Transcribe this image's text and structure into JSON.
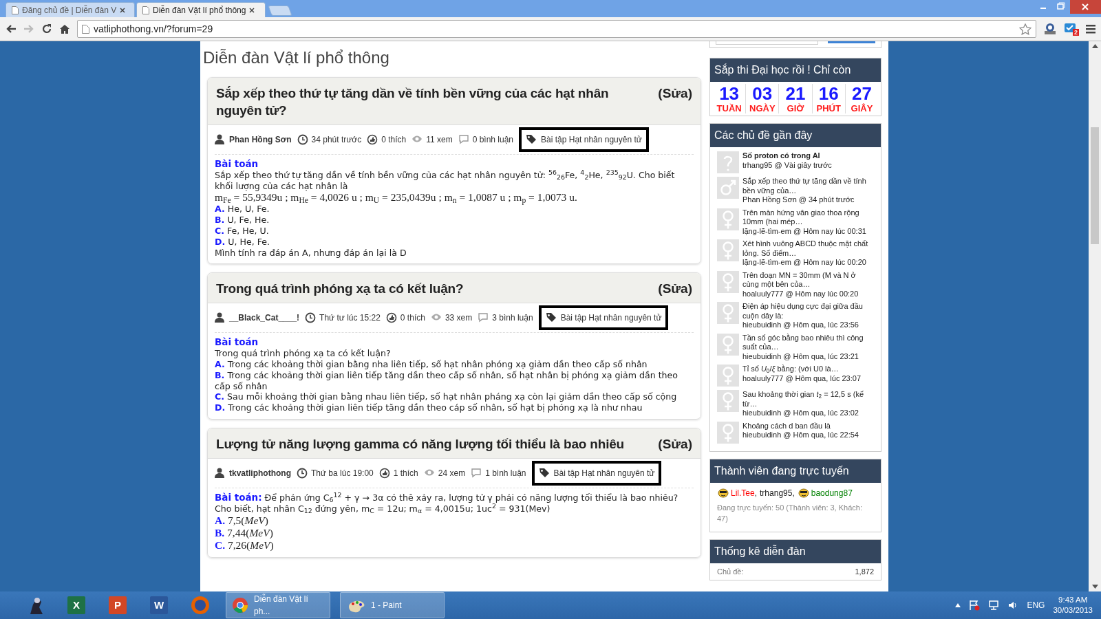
{
  "browser": {
    "tabs": [
      {
        "title": "Đăng chủ đề | Diễn đàn V",
        "selected": false
      },
      {
        "title": "Diễn đàn Vật lí phổ thông",
        "selected": true
      }
    ],
    "address": "vatliphothong.vn/?forum=29",
    "extension_badge": "2"
  },
  "forum": {
    "title": "Diễn đàn Vật lí phổ thông",
    "posts": [
      {
        "title": "Sắp xếp theo thứ tự tăng dần về tính bền vững của các hạt nhân nguyên tử?",
        "edit_label": "(Sửa)",
        "author": "Phan Hồng Sơn",
        "time": "34 phút trước",
        "likes": "0 thích",
        "views": "11 xem",
        "comments": "0 bình luận",
        "tag": "Bài tập Hạt nhân nguyên tử",
        "tag_highlighted": true,
        "body": [
          {
            "kind": "heading",
            "text": "Bài toán"
          },
          {
            "kind": "text",
            "text": "Sắp xếp theo thứ tự tăng dần về tính bền vững của các hạt nhân nguyên tử: $^{56}$$_{26}$Fe, $^{4}$$_{2}$He, $^{235}$$_{92}$U. Cho biết khối lượng của các hạt nhân là"
          },
          {
            "kind": "math",
            "text": "m$_{Fe}$ = 55,9349u ; m$_{He}$ = 4,0026 u ; m$_{U}$ = 235,0439u ; m$_{n}$ = 1,0087 u ; m$_{p}$ = 1,0073 u."
          },
          {
            "kind": "option",
            "letter": "A.",
            "text": "He, U, Fe."
          },
          {
            "kind": "option",
            "letter": "B.",
            "text": "U, Fe, He."
          },
          {
            "kind": "option",
            "letter": "C.",
            "text": "Fe, He, U."
          },
          {
            "kind": "option",
            "letter": "D.",
            "text": "U, He, Fe."
          },
          {
            "kind": "text",
            "text": "Mình tính ra đáp án A, nhưng đáp án lại là D"
          }
        ]
      },
      {
        "title": "Trong quá trình phóng xạ ta có kết luận?",
        "edit_label": "(Sửa)",
        "author": "__Black_Cat____!",
        "time": "Thứ tư lúc 15:22",
        "likes": "0 thích",
        "views": "33 xem",
        "comments": "3 bình luận",
        "tag": "Bài tập Hạt nhân nguyên tử",
        "tag_highlighted": true,
        "body": [
          {
            "kind": "heading",
            "text": "Bài toán"
          },
          {
            "kind": "text",
            "text": "Trong quá trình phóng xạ ta có kết luận?"
          },
          {
            "kind": "option",
            "letter": "A.",
            "text": "Trong các khoảng thời gian bằng nha liên tiếp, số hạt nhân phóng xạ giảm dần theo cấp số nhân"
          },
          {
            "kind": "option",
            "letter": "B.",
            "text": "Trong các khoảng thời gian liên tiếp tăng dần theo cấp số nhân, số hạt nhân bị phóng xạ giảm dần theo cấp số nhân"
          },
          {
            "kind": "option",
            "letter": "C.",
            "text": "Sau mỗi khoảng thời gian bằng nhau liên tiếp, số hạt nhân pháng xạ còn lại giảm dần theo cấp số cộng"
          },
          {
            "kind": "option",
            "letter": "D.",
            "text": "Trong các khoảng thời gian liên tiếp tăng dần theo cáp số nhân, số hạt bị phóng xạ là như nhau"
          }
        ]
      },
      {
        "title": "Lượng tử năng lượng gamma có năng lượng tối thiểu là bao nhiêu",
        "edit_label": "(Sửa)",
        "author": "tkvatliphothong",
        "time": "Thứ ba lúc 19:00",
        "likes": "1 thích",
        "views": "24 xem",
        "comments": "1 bình luận",
        "tag": "Bài tập Hạt nhân nguyên tử",
        "tag_highlighted": true,
        "body": [
          {
            "kind": "lead",
            "label": "Bài toán:",
            "text": "Để phản ứng C$_{6}$$^{12}$ + γ → 3α có thê xảy ra, lượng tử γ phải có năng lượng tối thiểu là bao nhiêu? Cho biết, hạt nhân C$_{12}$ đứng yên, m$_{C}$ = 12u; m$_{α}$ = 4,0015u; 1uc$^{2}$ = 931(Mev)"
          },
          {
            "kind": "math_option",
            "letter": "A.",
            "text": "7,5(*MeV*)"
          },
          {
            "kind": "math_option",
            "letter": "B.",
            "text": "7,44(*MeV*)"
          },
          {
            "kind": "math_option",
            "letter": "C.",
            "text": "7,26(*MeV*)"
          }
        ]
      }
    ]
  },
  "sidebar": {
    "countdown": {
      "title": "Sắp thi Đại học rồi ! Chỉ còn",
      "units": [
        {
          "value": "13",
          "label": "TUẦN"
        },
        {
          "value": "03",
          "label": "NGÀY"
        },
        {
          "value": "21",
          "label": "GIỜ"
        },
        {
          "value": "16",
          "label": "PHÚT"
        },
        {
          "value": "27",
          "label": "GIÂY"
        }
      ]
    },
    "recent": {
      "title": "Các chủ đề gần đây",
      "items": [
        {
          "kind": "question",
          "title": "Số proton có trong Al",
          "emphasized": true,
          "meta": "trhang95 @ Vài giây trước"
        },
        {
          "kind": "male",
          "title": "Sắp xếp theo thứ tự tăng dần về tính bền vững của…",
          "emphasized": false,
          "meta": "Phan Hồng Sơn @ 34 phút trước"
        },
        {
          "kind": "female",
          "title": "Trên màn hứng vân giao thoa rộng 10mm (hai mép…",
          "emphasized": false,
          "meta": "lặng-lẽ-tìm-em @ Hôm nay lúc 00:31"
        },
        {
          "kind": "female",
          "title": "Xét hình vuông ABCD thuộc mặt chất lỏng. Số điểm…",
          "emphasized": false,
          "meta": "lặng-lẽ-tìm-em @ Hôm nay lúc 00:20"
        },
        {
          "kind": "female",
          "title": "Trên đoạn MN = 30mm (M và N ở cùng một bên của…",
          "emphasized": false,
          "meta": "hoaluuly777 @ Hôm nay lúc 00:20"
        },
        {
          "kind": "female",
          "title": "Điện áp hiệu dụng cực đại giữa đầu cuộn dây là:",
          "emphasized": false,
          "meta": "hieubuidinh @ Hôm qua, lúc 23:56"
        },
        {
          "kind": "female",
          "title": "Tần số góc bằng bao nhiêu thì công suất của…",
          "emphasized": false,
          "meta": "hieubuidinh @ Hôm qua, lúc 23:21"
        },
        {
          "kind": "female",
          "title": "Tỉ số *U*$_{0}$/*ξ* bằng: (với U0 là…",
          "emphasized": false,
          "meta": "hoaluuly777 @ Hôm qua, lúc 23:07"
        },
        {
          "kind": "female",
          "title": "Sau khoảng thời gian *t*$_{2}$ = 12,5 s (kế từ…",
          "emphasized": false,
          "meta": "hieubuidinh @ Hôm qua, lúc 23:02"
        },
        {
          "kind": "female",
          "title": "Khoảng cách d ban đầu là",
          "emphasized": false,
          "meta": "hieubuidinh @ Hôm qua, lúc 22:54"
        }
      ]
    },
    "online": {
      "title": "Thành viên đang trực tuyến",
      "members": [
        {
          "name": "Lil.Tee",
          "color": "#ff0000",
          "icon": true,
          "separator": ","
        },
        {
          "name": "trhang95",
          "color": "#222222",
          "icon": false,
          "separator": ","
        },
        {
          "name": "baodung87",
          "color": "#008000",
          "icon": true
        }
      ],
      "summary": "Đang trực tuyến: 50 (Thành viên: 3, Khách: 47)"
    },
    "stats": {
      "title": "Thống kê diễn đàn",
      "rows": [
        {
          "label": "Chủ đề:",
          "value": "1,872"
        }
      ]
    }
  },
  "taskbar": {
    "apps": [
      {
        "kind": "media"
      },
      {
        "kind": "excel",
        "glyph": "X"
      },
      {
        "kind": "powerpoint",
        "glyph": "P"
      },
      {
        "kind": "word",
        "glyph": "W"
      },
      {
        "kind": "firefox"
      },
      {
        "kind": "chrome",
        "label": "Diễn đàn Vật lí ph..."
      },
      {
        "kind": "paint",
        "label": "1 - Paint"
      }
    ],
    "language": "ENG",
    "time": "9:43 AM",
    "date": "30/03/2013"
  }
}
